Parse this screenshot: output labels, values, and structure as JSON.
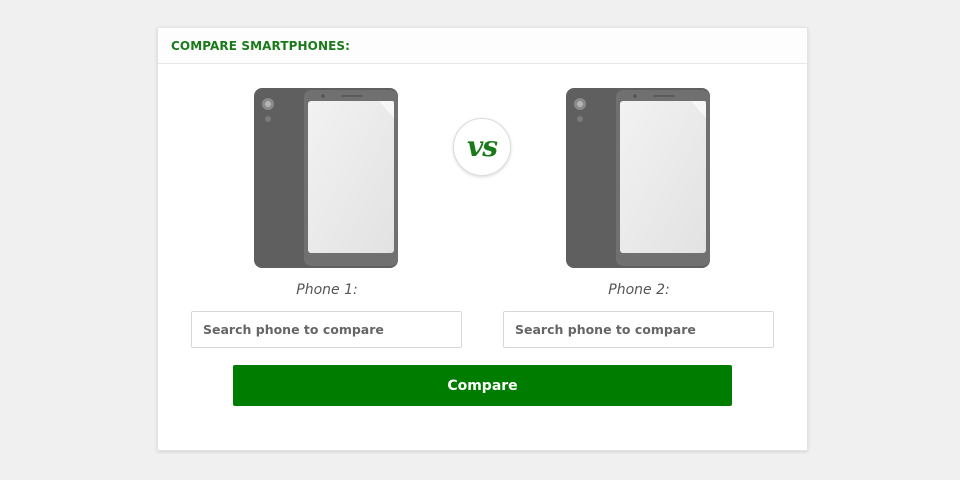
{
  "header": {
    "title": "COMPARE SMARTPHONES:"
  },
  "vs_badge": {
    "text": "vs"
  },
  "phones": [
    {
      "label": "Phone 1:",
      "search_placeholder": "Search phone to compare"
    },
    {
      "label": "Phone 2:",
      "search_placeholder": "Search phone to compare"
    }
  ],
  "compare_button": {
    "label": "Compare"
  },
  "colors": {
    "accent": "#007d00",
    "title": "#1a7a1a",
    "page_bg": "#f0f0f0"
  }
}
